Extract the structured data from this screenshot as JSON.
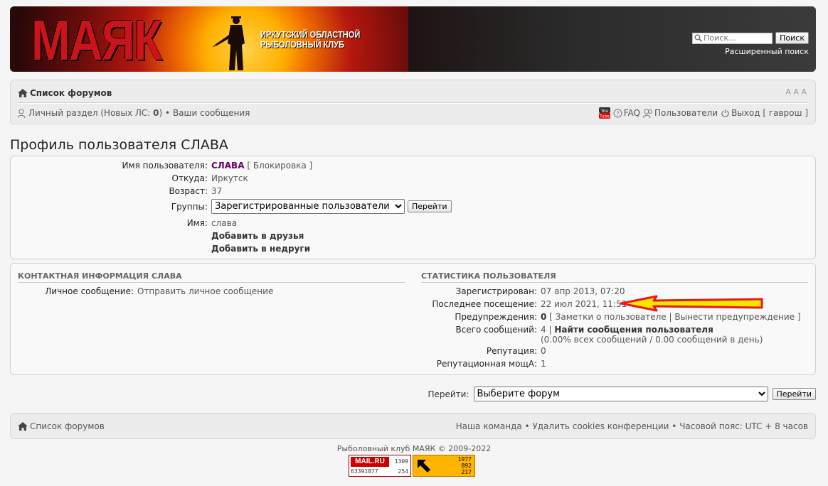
{
  "header": {
    "logo_text": "МАЯК",
    "club_name_line1": "ИРКУТСКИЙ ОБЛАСТНОЙ",
    "club_name_line2": "РЫБОЛОВНЫЙ КЛУБ",
    "search_placeholder": "Поиск…",
    "search_button": "Поиск",
    "advanced_search": "Расширенный поиск"
  },
  "nav": {
    "forum_index": "Список форумов",
    "font_resize": "A A A",
    "ucp_label": "Личный раздел",
    "new_pm_prefix": "(Новых ЛС: ",
    "new_pm_count": "0",
    "new_pm_suffix": ")",
    "your_posts": "Ваши сообщения",
    "faq": "FAQ",
    "members": "Пользователи",
    "logout": "Выход",
    "logout_user": "гаврош"
  },
  "page_title": "Профиль пользователя СЛАВА",
  "profile": {
    "username_label": "Имя пользователя:",
    "username": "СЛАВА",
    "ban": "Блокировка",
    "location_label": "Откуда:",
    "location": "Иркутск",
    "age_label": "Возраст:",
    "age": "37",
    "groups_label": "Группы:",
    "group_selected": "Зарегистрированные пользователи",
    "go_button": "Перейти",
    "name_label": "Имя:",
    "name": "слава",
    "add_friend": "Добавить в друзья",
    "add_foe": "Добавить в недруги"
  },
  "contact": {
    "heading": "КОНТАКТНАЯ ИНФОРМАЦИЯ СЛАВА",
    "pm_label": "Личное сообщение:",
    "pm_link": "Отправить личное сообщение"
  },
  "stats": {
    "heading": "СТАТИСТИКА ПОЛЬЗОВАТЕЛЯ",
    "registered_label": "Зарегистрирован:",
    "registered": "07 апр 2013, 07:20",
    "last_visit_label": "Последнее посещение:",
    "last_visit": "22 июл 2021, 11:51",
    "warnings_label": "Предупреждения:",
    "warnings": "0",
    "user_notes": "Заметки о пользователе",
    "issue_warning": "Вынести предупреждение",
    "posts_label": "Всего сообщений:",
    "posts": "4",
    "find_posts": "Найти сообщения пользователя",
    "posts_ratio": "(0.00% всех сообщений / 0.00 сообщений в день)",
    "reputation_label": "Репутация:",
    "reputation": "0",
    "rep_power_label": "Репутационная мощА:",
    "rep_power": "1"
  },
  "jump": {
    "label": "Перейти:",
    "selected": "Выберите форум",
    "button": "Перейти"
  },
  "footer": {
    "forum_index": "Список форумов",
    "team": "Наша команда",
    "delete_cookies": "Удалить cookies конференции",
    "timezone": "Часовой пояс: UTC + 8 часов",
    "copyright": "Рыболовный клуб МАЯК © 2009-2022"
  },
  "counters": {
    "mail_brand": "MAIL.RU",
    "mail_total": "63391877",
    "mail_a": "1309",
    "mail_b": "254",
    "yandex_a": "1977",
    "yandex_b": "892",
    "yandex_c": "217"
  },
  "colors": {
    "logo_red": "#c8141a",
    "username": "#660066",
    "arrow": "#e8191a",
    "arrow_fill": "#f5e600"
  }
}
